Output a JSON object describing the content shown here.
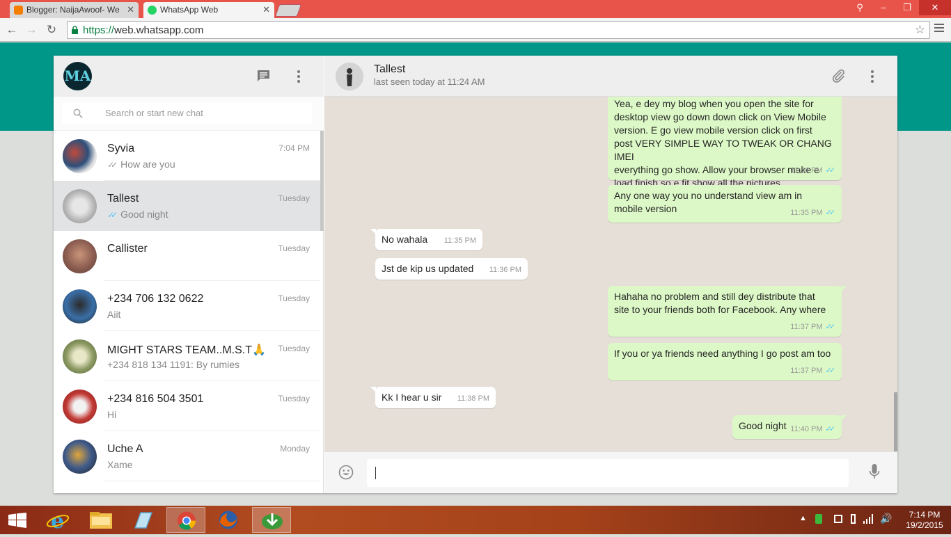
{
  "browser": {
    "tabs": [
      {
        "label": "Blogger: NaijaAwoof- We",
        "favicon_color": "#f57d00"
      },
      {
        "label": "WhatsApp Web",
        "favicon_color": "#25d366"
      }
    ],
    "url_scheme": "https://",
    "url_host": "web.whatsapp.com"
  },
  "sidebar": {
    "avatar_text": "MA",
    "search_placeholder": "Search or start new chat",
    "chats": [
      {
        "name": "Syvia",
        "time": "7:04 PM",
        "last": "How are you",
        "tick": "grey"
      },
      {
        "name": "Tallest",
        "time": "Tuesday",
        "last": "Good night",
        "tick": "read",
        "selected": true
      },
      {
        "name": "Callister",
        "time": "Tuesday",
        "last": ""
      },
      {
        "name": "+234 706 132 0622",
        "time": "Tuesday",
        "last": "Aiit"
      },
      {
        "name": "MIGHT STARS TEAM..M.S.T🙏",
        "time": "Tuesday",
        "last": "+234 818 134 1191: By rumies"
      },
      {
        "name": "+234 816 504 3501",
        "time": "Tuesday",
        "last": "Hi"
      },
      {
        "name": "Uche A",
        "time": "Monday",
        "last": "Xame"
      }
    ]
  },
  "conversation": {
    "contact_name": "Tallest",
    "contact_status": "last seen today at 11:24 AM",
    "messages": [
      {
        "dir": "out",
        "lines": [
          "Yea, e dey my blog when you open the site for",
          "desktop view go down down click on View Mobile",
          "version. E go view mobile version click on first",
          "post VERY SIMPLE WAY TO TWEAK OR CHANG IMEI",
          "everything go show. Allow your browser make e",
          "load finish so e fit show all the pictures"
        ],
        "time": "11:34 PM",
        "tick": "read"
      },
      {
        "dir": "out",
        "lines": [
          "Any one way you no understand view am in",
          "mobile version"
        ],
        "time": "11:35 PM",
        "tick": "read"
      },
      {
        "dir": "in",
        "lines": [
          "No wahala"
        ],
        "time": "11:35 PM"
      },
      {
        "dir": "in",
        "lines": [
          "Jst de kip us updated"
        ],
        "time": "11:36 PM"
      },
      {
        "dir": "out",
        "lines": [
          "Hahaha no problem and still dey distribute that",
          "site to your friends both for Facebook. Any where"
        ],
        "time": "11:37 PM",
        "tick": "read"
      },
      {
        "dir": "out",
        "lines": [
          "If you or ya friends need anything I go post am too"
        ],
        "time": "11:37 PM",
        "tick": "read"
      },
      {
        "dir": "in",
        "lines": [
          "Kk I hear u sir"
        ],
        "time": "11:38 PM"
      },
      {
        "dir": "out",
        "lines": [
          "Good night"
        ],
        "time": "11:40 PM",
        "tick": "read"
      }
    ]
  },
  "taskbar": {
    "time": "7:14 PM",
    "date": "19/2/2015"
  },
  "colors": {
    "accent_teal": "#009688",
    "outgoing_bubble": "#dcf8c6",
    "read_tick": "#4fc3f7",
    "titlebar_red": "#e8544a"
  }
}
